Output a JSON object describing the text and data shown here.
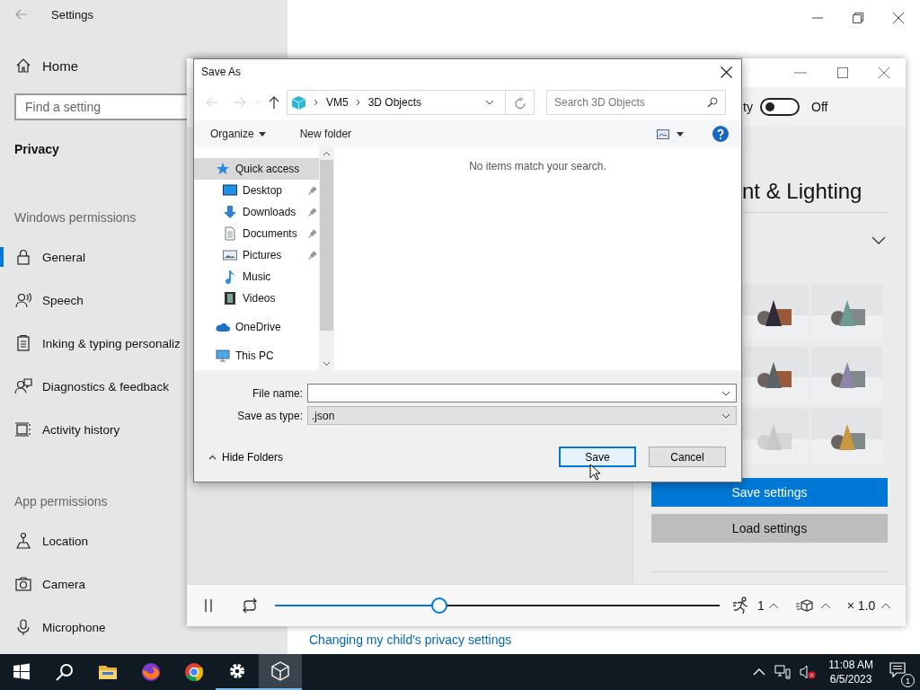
{
  "settings": {
    "title": "Settings",
    "home": "Home",
    "search": {
      "placeholder": "Find a setting"
    },
    "section": "Privacy",
    "groups": [
      {
        "heading": "Windows permissions",
        "items": [
          {
            "label": "General",
            "kind": "lock",
            "selected": true
          },
          {
            "label": "Speech",
            "kind": "speech",
            "selected": false
          },
          {
            "label": "Inking & typing personaliz",
            "kind": "clipboard",
            "selected": false
          },
          {
            "label": "Diagnostics & feedback",
            "kind": "feedback",
            "selected": false
          },
          {
            "label": "Activity history",
            "kind": "timeline",
            "selected": false
          }
        ]
      },
      {
        "heading": "App permissions",
        "items": [
          {
            "label": "Location",
            "kind": "location",
            "selected": false
          },
          {
            "label": "Camera",
            "kind": "camera",
            "selected": false
          },
          {
            "label": "Microphone",
            "kind": "microphone",
            "selected": false
          }
        ]
      }
    ],
    "link": "Changing my child's privacy settings"
  },
  "viewer": {
    "toggle": {
      "label": "ty",
      "on": false,
      "state": "Off"
    },
    "heading": "nt & Lighting",
    "expanded": false,
    "themes": [
      {
        "color": "#2e2a36"
      },
      {
        "color": "#6f9a92"
      },
      {
        "color": "#5c6366"
      },
      {
        "color": "#8c86a8"
      },
      {
        "color": "#c8c8c8"
      },
      {
        "color": "#c9973f"
      }
    ],
    "buttons": [
      {
        "label": "Save settings",
        "kind": "primary"
      },
      {
        "label": "Load settings",
        "kind": "secondary"
      }
    ],
    "playback": {
      "playing": true,
      "level": 0.37,
      "speed": "1",
      "scale": "× 1.0"
    }
  },
  "dialog": {
    "title": "Save As",
    "path": [
      "VM5",
      "3D Objects"
    ],
    "search": {
      "placeholder": "Search 3D Objects"
    },
    "toolbar": [
      "Organize",
      "New folder"
    ],
    "nav": [
      {
        "label": "Quick access",
        "kind": "star",
        "selected": true,
        "children": [
          {
            "label": "Desktop",
            "kind": "desktop",
            "pinned": true,
            "selected": false
          },
          {
            "label": "Downloads",
            "kind": "download",
            "pinned": true,
            "selected": false
          },
          {
            "label": "Documents",
            "kind": "document",
            "pinned": true,
            "selected": false
          },
          {
            "label": "Pictures",
            "kind": "pictures",
            "pinned": true,
            "selected": false
          },
          {
            "label": "Music",
            "kind": "music",
            "pinned": false,
            "selected": false
          },
          {
            "label": "Videos",
            "kind": "videos",
            "pinned": false,
            "selected": false
          }
        ]
      },
      {
        "label": "OneDrive",
        "kind": "cloud",
        "selected": false
      },
      {
        "label": "This PC",
        "kind": "pc",
        "selected": false
      }
    ],
    "message": "No items match your search.",
    "file_name": {
      "label": "File name:"
    },
    "file_type": {
      "label": "Save as type:",
      "value": ".json"
    },
    "hide_folders": "Hide Folders",
    "buttons": [
      {
        "label": "Save",
        "default": true
      },
      {
        "label": "Cancel",
        "default": false
      }
    ]
  },
  "taskbar": {
    "apps": [
      {
        "kind": "start",
        "running": false,
        "active": false
      },
      {
        "kind": "search",
        "running": false,
        "active": false
      },
      {
        "kind": "folder",
        "running": false,
        "active": false
      },
      {
        "kind": "fox",
        "running": false,
        "active": false
      },
      {
        "kind": "chrome",
        "running": false,
        "active": false
      },
      {
        "kind": "gear",
        "running": true,
        "active": false
      },
      {
        "kind": "cube",
        "running": true,
        "active": true
      }
    ],
    "tray": {
      "muted": true,
      "time": "11:08 AM",
      "date": "6/5/2023",
      "notifications": "1"
    }
  }
}
